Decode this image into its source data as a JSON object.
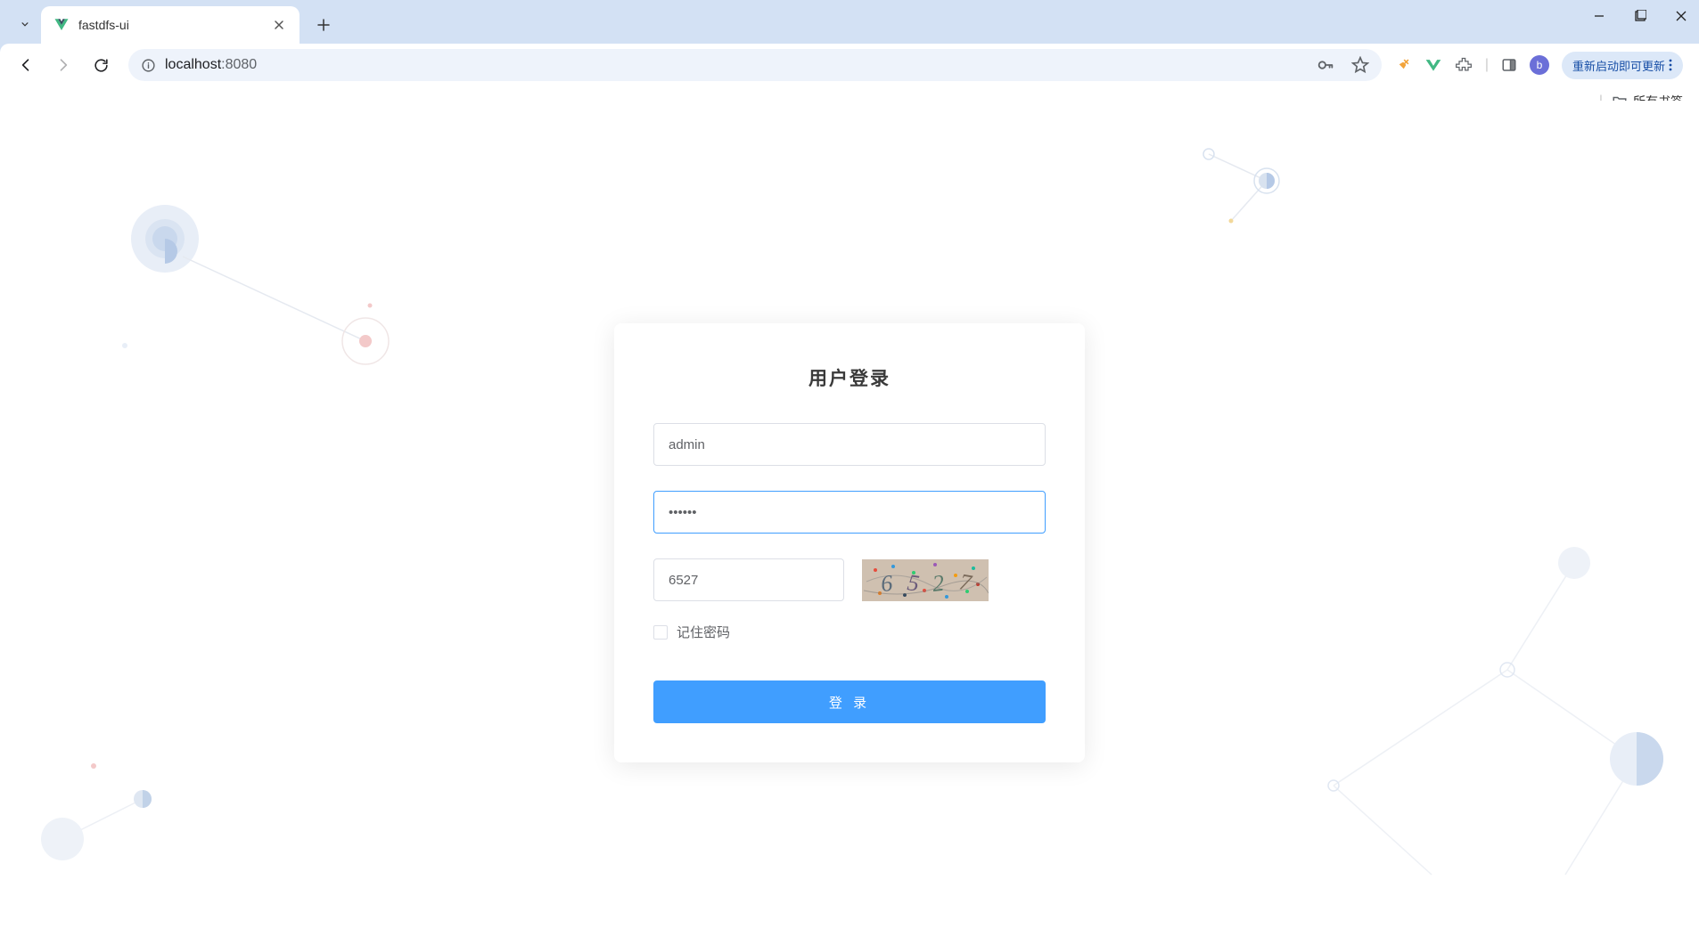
{
  "browser": {
    "tab_title": "fastdfs-ui",
    "url_host": "localhost",
    "url_port": ":8080",
    "update_label": "重新启动即可更新",
    "avatar_letter": "b",
    "all_bookmarks": "所有书签"
  },
  "login": {
    "title": "用户登录",
    "username_value": "admin",
    "password_value": "••••••",
    "captcha_value": "6527",
    "captcha_display": "6527",
    "remember_label": "记住密码",
    "submit_label": "登 录"
  }
}
